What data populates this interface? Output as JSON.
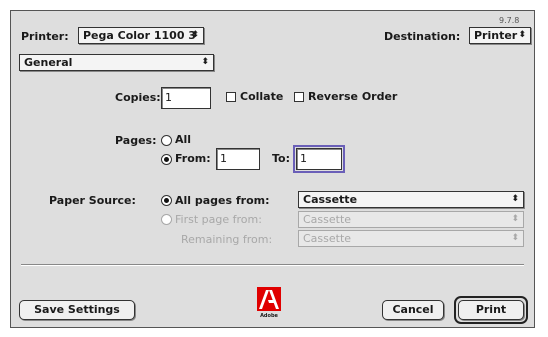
{
  "version": "9.7.8",
  "header": {
    "printer_label": "Printer:",
    "printer_value": "Pega Color 1100 3",
    "destination_label": "Destination:",
    "destination_value": "Printer"
  },
  "panel_menu": {
    "value": "General"
  },
  "copies": {
    "label": "Copies:",
    "value": "1",
    "collate_label": "Collate",
    "collate_checked": false,
    "reverse_label": "Reverse Order",
    "reverse_checked": false
  },
  "pages": {
    "label": "Pages:",
    "all_label": "All",
    "from_label": "From:",
    "from_value": "1",
    "to_label": "To:",
    "to_value": "1",
    "selected": "from"
  },
  "paper_source": {
    "label": "Paper Source:",
    "all_pages_label": "All pages from:",
    "all_pages_value": "Cassette",
    "first_page_label": "First page from:",
    "first_page_value": "Cassette",
    "remaining_label": "Remaining from:",
    "remaining_value": "Cassette",
    "selected": "all_pages"
  },
  "footer": {
    "save_label": "Save Settings",
    "logo_text": "Adobe",
    "cancel_label": "Cancel",
    "print_label": "Print"
  },
  "colors": {
    "dialog_bg": "#dedede",
    "focus_ring": "#6a5fb8",
    "adobe_red": "#e00000"
  }
}
